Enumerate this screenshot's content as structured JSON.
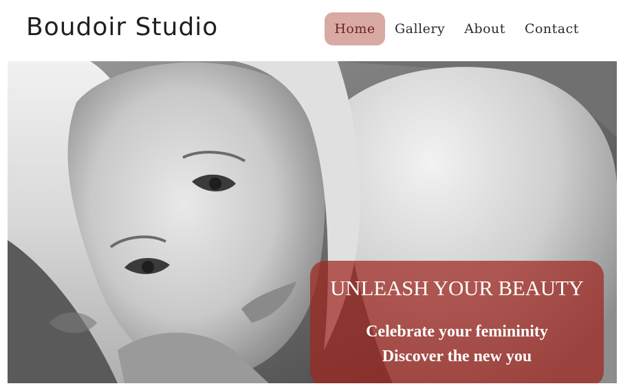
{
  "site": {
    "brand": "Boudoir Studio"
  },
  "nav": {
    "items": [
      {
        "label": "Home",
        "active": true
      },
      {
        "label": "Gallery",
        "active": false
      },
      {
        "label": "About",
        "active": false
      },
      {
        "label": "Contact",
        "active": false
      }
    ],
    "active_bg": "#d9aaa3",
    "active_text": "#6a2320"
  },
  "hero": {
    "title": "UNLEASH YOUR BEAUTY",
    "line1": "Celebrate your femininity",
    "line2": "Discover the new you",
    "overlay_color": "#a0261e"
  }
}
